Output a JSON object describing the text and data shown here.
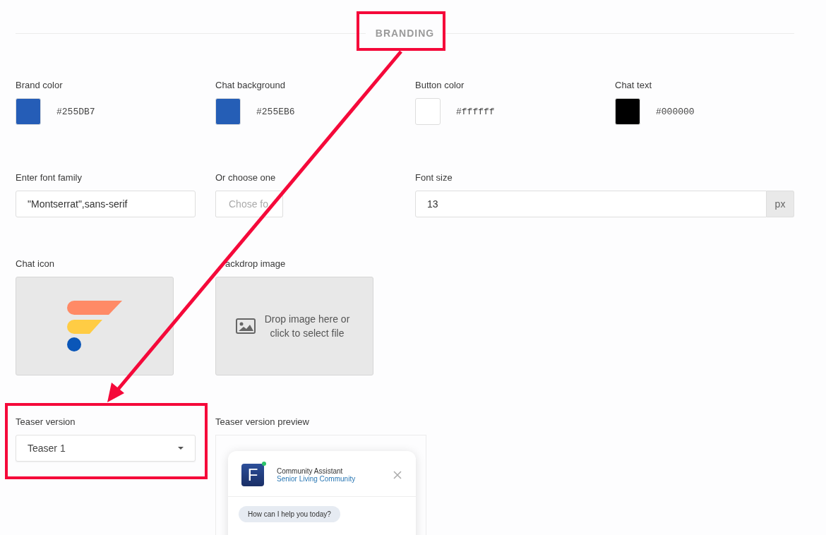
{
  "section_title": "BRANDING",
  "colors": [
    {
      "label": "Brand color",
      "value": "#255DB7",
      "color": "#255db7"
    },
    {
      "label": "Chat background",
      "value": "#255EB6",
      "color": "#255eb6"
    },
    {
      "label": "Button color",
      "value": "#ffffff",
      "color": "#ffffff"
    },
    {
      "label": "Chat text",
      "value": "#000000",
      "color": "#000000"
    }
  ],
  "font_family": {
    "label": "Enter font family",
    "value": "\"Montserrat\",sans-serif"
  },
  "font_choice": {
    "label": "Or choose one",
    "placeholder": "Chose fo"
  },
  "font_size": {
    "label": "Font size",
    "value": "13",
    "unit": "px"
  },
  "chat_icon": {
    "label": "Chat icon"
  },
  "backdrop": {
    "label": "ackdrop image",
    "hint": "Drop image here or click to select file"
  },
  "teaser": {
    "label": "Teaser version",
    "value": "Teaser 1"
  },
  "preview": {
    "label": "Teaser version preview",
    "avatar_letter": "F",
    "bot_name": "Community Assistant",
    "community": "Senior Living Community",
    "message": "How can I help you today?"
  }
}
